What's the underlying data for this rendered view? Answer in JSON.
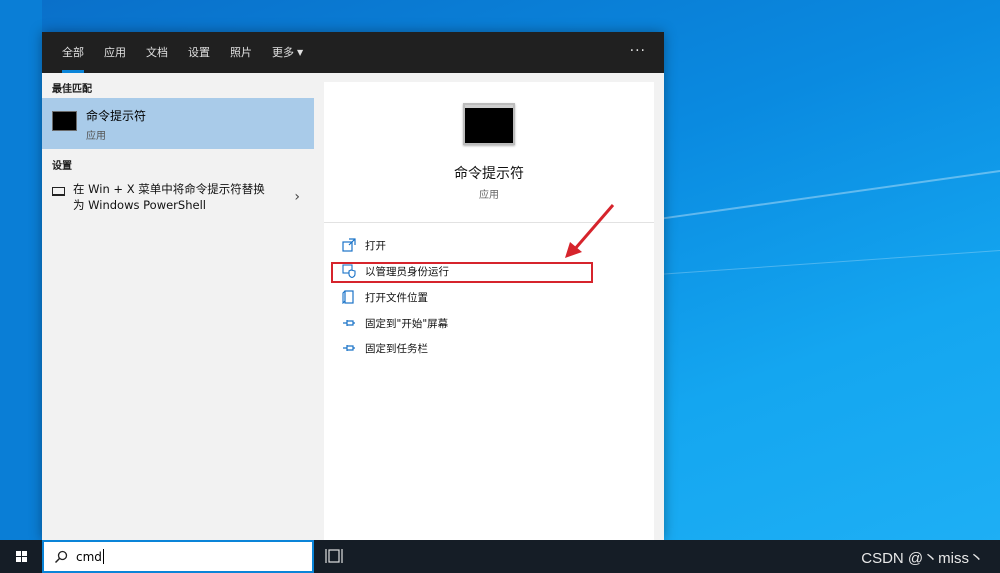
{
  "tabs": [
    {
      "label": "全部",
      "active": true
    },
    {
      "label": "应用"
    },
    {
      "label": "文档"
    },
    {
      "label": "设置"
    },
    {
      "label": "照片"
    },
    {
      "label": "更多"
    }
  ],
  "more_icon": "ellipsis-icon",
  "results": {
    "best_match_heading": "最佳匹配",
    "best_match": {
      "title": "命令提示符",
      "subtitle": "应用",
      "icon": "cmd-icon"
    },
    "settings_heading": "设置",
    "setting_item": {
      "text": "在 Win + X 菜单中将命令提示符替换为 Windows PowerShell",
      "icon": "monitor-icon"
    }
  },
  "detail": {
    "title": "命令提示符",
    "subtitle": "应用",
    "actions": [
      {
        "label": "打开",
        "icon": "open-icon"
      },
      {
        "label": "以管理员身份运行",
        "icon": "shield-admin-icon",
        "highlighted": true
      },
      {
        "label": "打开文件位置",
        "icon": "file-location-icon"
      },
      {
        "label": "固定到\"开始\"屏幕",
        "icon": "pin-icon"
      },
      {
        "label": "固定到任务栏",
        "icon": "pin-icon"
      }
    ]
  },
  "taskbar": {
    "search_value": "cmd",
    "watermark": "CSDN @丶miss丶"
  },
  "colors": {
    "accent": "#0a84d8",
    "highlight_red": "#d6242c",
    "selected_row": "#a9cbe9"
  }
}
